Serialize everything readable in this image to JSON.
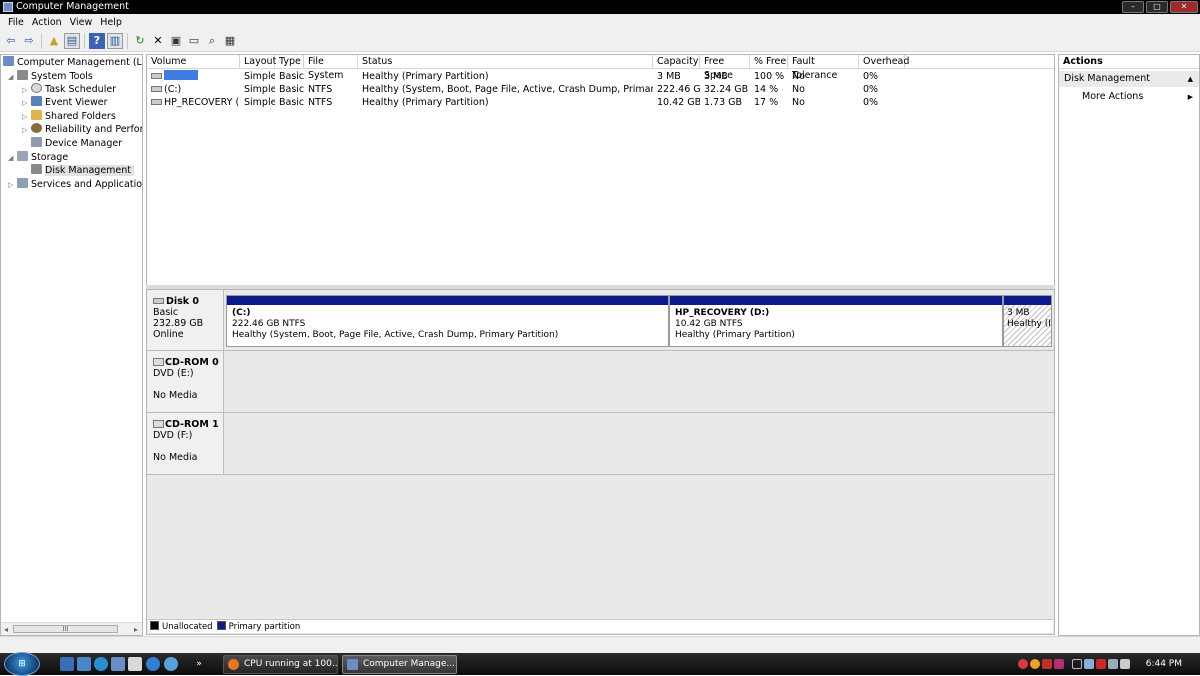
{
  "window": {
    "title": "Computer Management",
    "minimize": "–",
    "maximize": "□",
    "close": "✕"
  },
  "menu": [
    "File",
    "Action",
    "View",
    "Help"
  ],
  "toolbar": [
    {
      "name": "back-icon",
      "glyph": "⇦"
    },
    {
      "name": "forward-icon",
      "glyph": "⇨"
    },
    {
      "name": "up-folder-icon",
      "glyph": "▲"
    },
    {
      "name": "show-hide-tree-icon",
      "glyph": "▤"
    },
    {
      "name": "help-icon",
      "glyph": "?"
    },
    {
      "name": "properties-view-icon",
      "glyph": "▥"
    },
    {
      "name": "refresh-icon",
      "glyph": "↻"
    },
    {
      "name": "delete-icon",
      "glyph": "✕"
    },
    {
      "name": "properties-icon",
      "glyph": "▣"
    },
    {
      "name": "open-icon",
      "glyph": "▭"
    },
    {
      "name": "search-icon",
      "glyph": "⌕"
    },
    {
      "name": "export-icon",
      "glyph": "▦"
    }
  ],
  "tree": {
    "root": "Computer Management (Local",
    "system_tools": "System Tools",
    "task_scheduler": "Task Scheduler",
    "event_viewer": "Event Viewer",
    "shared_folders": "Shared Folders",
    "reliability": "Reliability and Performa",
    "device_manager": "Device Manager",
    "storage": "Storage",
    "disk_management": "Disk Management",
    "services": "Services and Applications",
    "scroll_thumb": "III"
  },
  "volume_table": {
    "columns": [
      "Volume",
      "Layout",
      "Type",
      "File System",
      "Status",
      "Capacity",
      "Free Space",
      "% Free",
      "Fault Tolerance",
      "Overhead"
    ],
    "rows": [
      {
        "volume": "",
        "layout": "Simple",
        "type": "Basic",
        "fs": "",
        "status": "Healthy (Primary Partition)",
        "capacity": "3 MB",
        "free": "3 MB",
        "pct": "100 %",
        "fault": "No",
        "overhead": "0%"
      },
      {
        "volume": "(C:)",
        "layout": "Simple",
        "type": "Basic",
        "fs": "NTFS",
        "status": "Healthy (System, Boot, Page File, Active, Crash Dump, Primary Partition)",
        "capacity": "222.46 GB",
        "free": "32.24 GB",
        "pct": "14 %",
        "fault": "No",
        "overhead": "0%"
      },
      {
        "volume": "HP_RECOVERY (D:)",
        "layout": "Simple",
        "type": "Basic",
        "fs": "NTFS",
        "status": "Healthy (Primary Partition)",
        "capacity": "10.42 GB",
        "free": "1.73 GB",
        "pct": "17 %",
        "fault": "No",
        "overhead": "0%"
      }
    ]
  },
  "disks": {
    "disk0": {
      "name": "Disk 0",
      "type": "Basic",
      "size": "232.89 GB",
      "state": "Online",
      "partitions": [
        {
          "label": "(C:)",
          "size": "222.46 GB NTFS",
          "status": "Healthy (System, Boot, Page File, Active, Crash Dump, Primary Partition)"
        },
        {
          "label": "HP_RECOVERY  (D:)",
          "size": "10.42 GB NTFS",
          "status": "Healthy (Primary Partition)"
        },
        {
          "label": "",
          "size": "3 MB",
          "status": "Healthy (I"
        }
      ]
    },
    "cd0": {
      "name": "CD-ROM 0",
      "drive": "DVD (E:)",
      "media": "No Media"
    },
    "cd1": {
      "name": "CD-ROM 1",
      "drive": "DVD (F:)",
      "media": "No Media"
    }
  },
  "legend": {
    "unallocated": "Unallocated",
    "primary": "Primary partition",
    "unallocated_color": "#000000",
    "primary_color": "#0b1a8c"
  },
  "actions": {
    "header": "Actions",
    "section": "Disk Management",
    "more": "More Actions"
  },
  "taskbar": {
    "start": "⊞",
    "overflow": "»",
    "tasks": [
      {
        "label": "CPU running at 100...",
        "color": "#e8761c"
      },
      {
        "label": "Computer Manage...",
        "color": "#6b8cc7"
      }
    ],
    "clock": "6:44 PM"
  }
}
